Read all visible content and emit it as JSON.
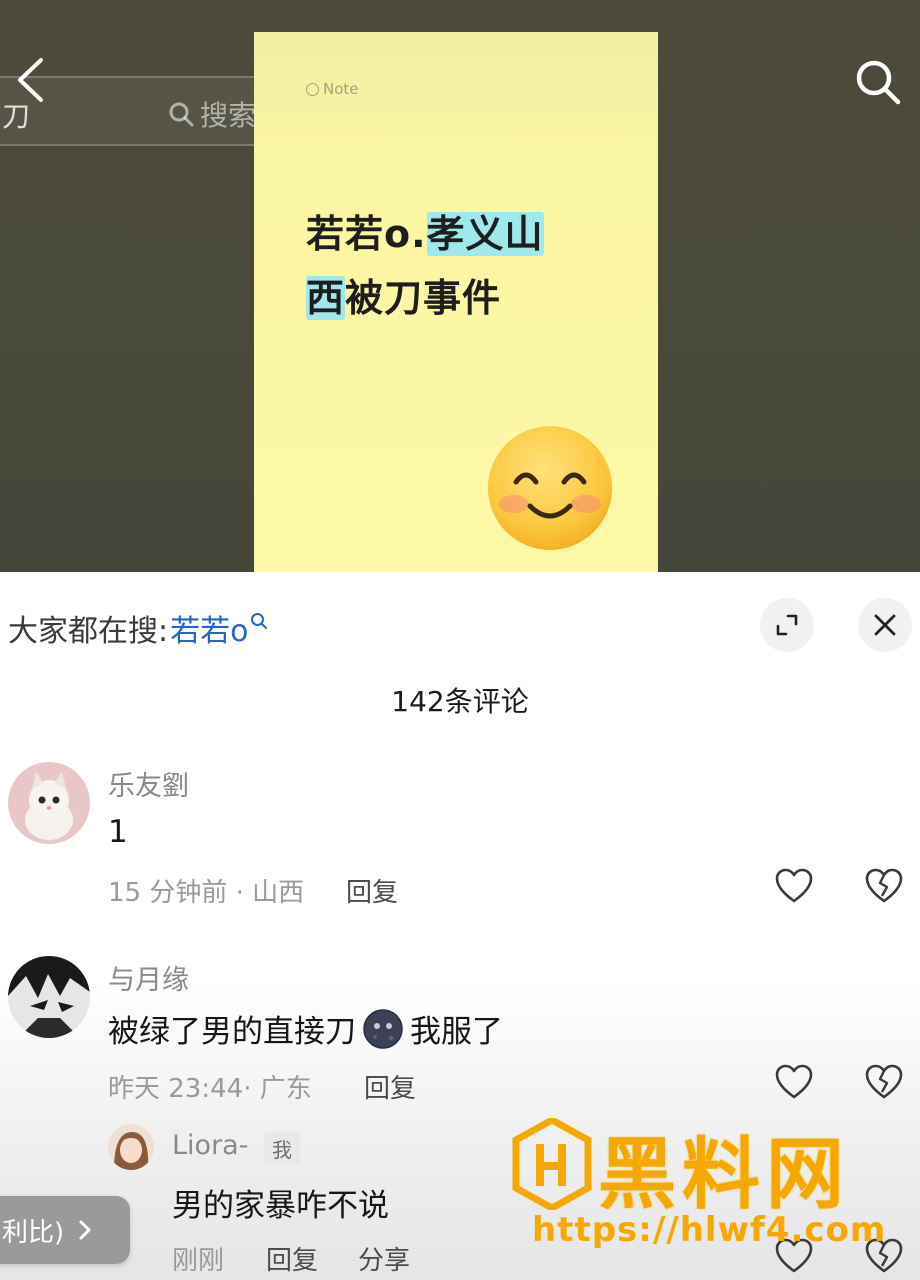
{
  "video": {
    "search_query": "刀",
    "search_label": "搜索",
    "note_tag": "Note",
    "note_title_part1": "若若o.",
    "note_title_hl1": "孝义山",
    "note_title_hl2": "西",
    "note_title_part2": "被刀事件"
  },
  "panel": {
    "hot_search_prefix": "大家都在搜:",
    "hot_search_term": "若若o",
    "comment_count": "142条评论"
  },
  "comments": [
    {
      "author": "乐友劉",
      "text": "1",
      "time_location": "15 分钟前 · 山西",
      "reply_label": "回复"
    },
    {
      "author": "与月缘",
      "text_before": "被绿了男的直接刀",
      "text_after": "我服了",
      "emoji": "moon-emoji",
      "time_location": "昨天 23:44· 广东",
      "reply_label": "回复"
    }
  ],
  "reply": {
    "author": "Liora-",
    "badge": "我",
    "text": "男的家暴咋不说",
    "time": "刚刚",
    "reply_label": "回复",
    "share_label": "分享"
  },
  "float_pill": {
    "label": "利比)"
  },
  "watermark": {
    "text": "黑料网",
    "url": "https://hlwf4.com"
  }
}
